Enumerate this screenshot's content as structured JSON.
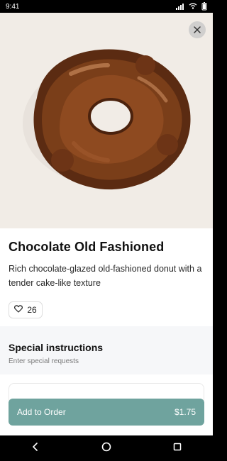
{
  "status_bar": {
    "time": "9:41",
    "icons": [
      "signal-icon",
      "wifi-icon",
      "battery-icon"
    ]
  },
  "hero": {
    "close_icon": "close-icon"
  },
  "product": {
    "title": "Chocolate Old Fashioned",
    "description": "Rich chocolate-glazed old-fashioned donut with a tender cake-like texture",
    "likes": "26"
  },
  "instructions": {
    "title": "Special instructions",
    "placeholder": "Enter special requests"
  },
  "order": {
    "label": "Add to Order",
    "price": "$1.75"
  },
  "nav": {
    "back_icon": "back-icon",
    "home_icon": "home-icon",
    "recents_icon": "recents-icon"
  },
  "colors": {
    "accent": "#6fa39e",
    "surface": "#f6f7f9"
  }
}
